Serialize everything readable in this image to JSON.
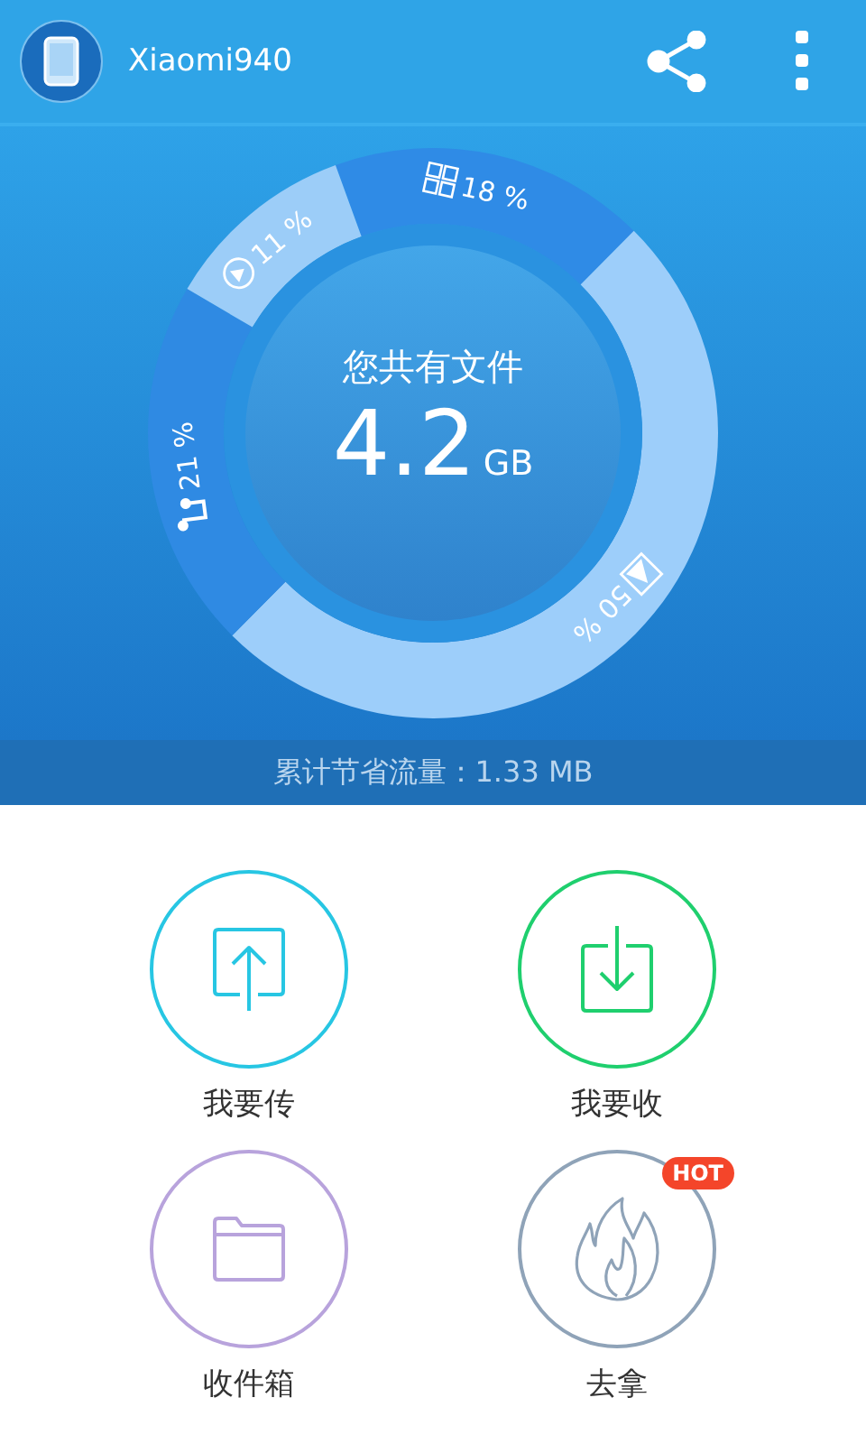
{
  "header": {
    "title": "Xiaomi940"
  },
  "storage": {
    "caption": "您共有文件",
    "amount": "4.2",
    "unit": "GB",
    "segment_icons": [
      {
        "kind": "apps"
      },
      {
        "kind": "image"
      },
      {
        "kind": "music"
      },
      {
        "kind": "video"
      }
    ],
    "chart_data": {
      "type": "donut",
      "values": [
        18,
        50,
        21,
        11
      ],
      "value_labels": [
        "18 %",
        "50 %",
        "21 %",
        "11 %"
      ],
      "colors": [
        "#2f8be6",
        "#9dcefa",
        "#2f8ae3",
        "#9ccdf8"
      ]
    }
  },
  "savings": "累计节省流量：1.33 MB",
  "actions": [
    {
      "kind": "send",
      "label": "我要传",
      "color": "#27c6e3"
    },
    {
      "kind": "receive",
      "label": "我要收",
      "color": "#1fcf6e"
    },
    {
      "kind": "inbox",
      "label": "收件箱",
      "color": "#b8a3dc"
    },
    {
      "kind": "hot",
      "label": "去拿",
      "color": "#8fa3b8",
      "badge": "HOT"
    }
  ]
}
